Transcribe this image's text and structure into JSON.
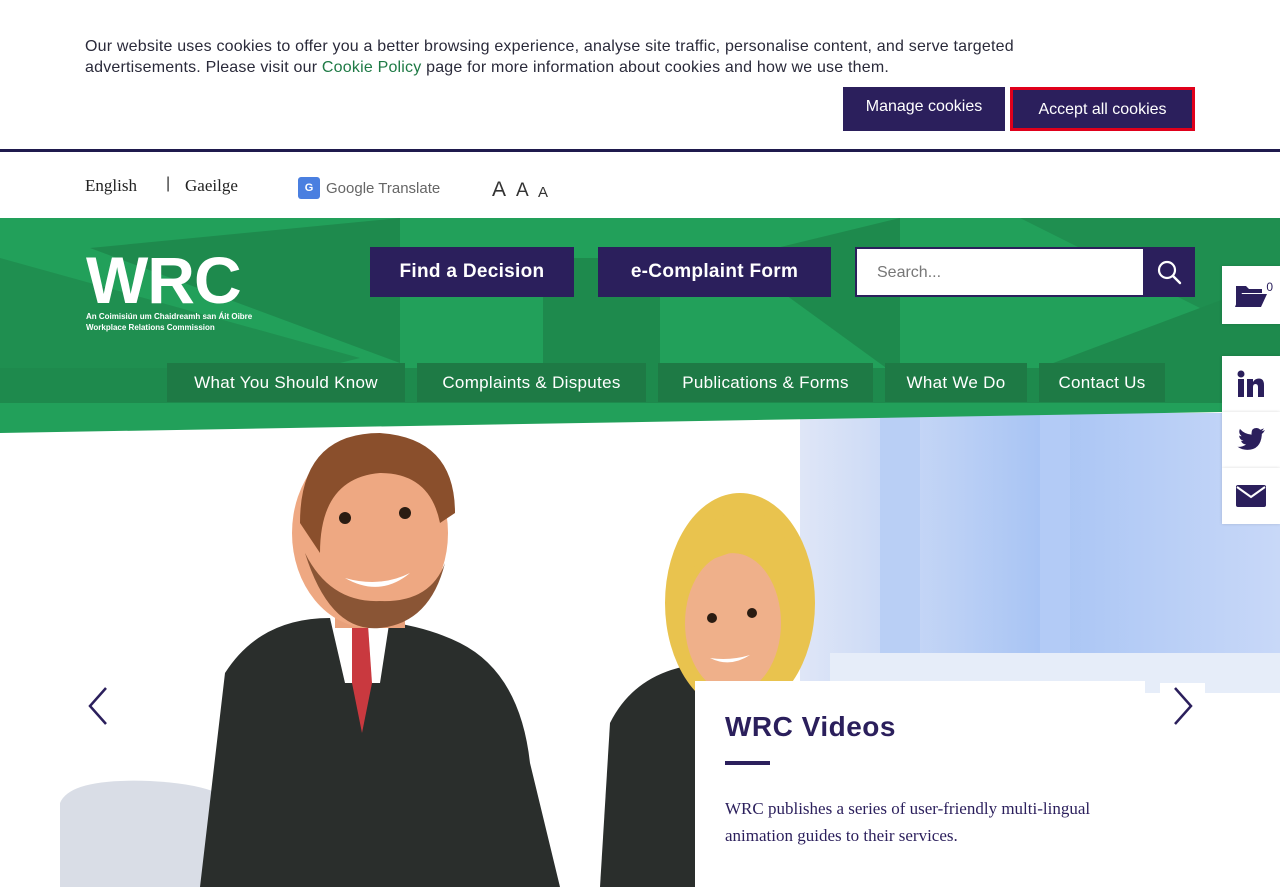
{
  "cookie_banner": {
    "text_before": "Our website uses cookies to offer you a better browsing experience, analyse site traffic, personalise content, and serve targeted advertisements. Please visit our ",
    "policy_link": "Cookie Policy",
    "text_after": " page for more information about cookies and how we use them.",
    "manage_label": "Manage cookies",
    "accept_label": "Accept all cookies"
  },
  "utility": {
    "lang_english": "English",
    "separator": "|",
    "lang_irish": "Gaeilge",
    "translate_label": "Google Translate",
    "translate_icon_text": "G",
    "font_sizes": [
      "A",
      "A",
      "A"
    ]
  },
  "header": {
    "logo_main": "WRC",
    "logo_sub_1": "An Coimisiún um Chaidreamh san Áit Oibre",
    "logo_sub_2": "Workplace Relations Commission",
    "find_decision": "Find a Decision",
    "ecomplaint": "e-Complaint Form",
    "search_placeholder": "Search..."
  },
  "nav": {
    "items": [
      "What You Should Know",
      "Complaints & Disputes",
      "Publications & Forms",
      "What We Do",
      "Contact Us"
    ]
  },
  "hero": {
    "title": "WRC Videos",
    "text": "WRC publishes a series of user-friendly multi-lingual animation guides to their services."
  },
  "side": {
    "folder_count": "0"
  },
  "colors": {
    "brand_purple": "#2b1f5c",
    "brand_green": "#22a05a",
    "nav_green": "#1e7a45",
    "accept_border": "#e0001b"
  },
  "icons": [
    "search-icon",
    "folder-open-icon",
    "linkedin-icon",
    "twitter-icon",
    "email-icon",
    "chevron-left-icon",
    "chevron-right-icon",
    "google-translate-icon"
  ]
}
